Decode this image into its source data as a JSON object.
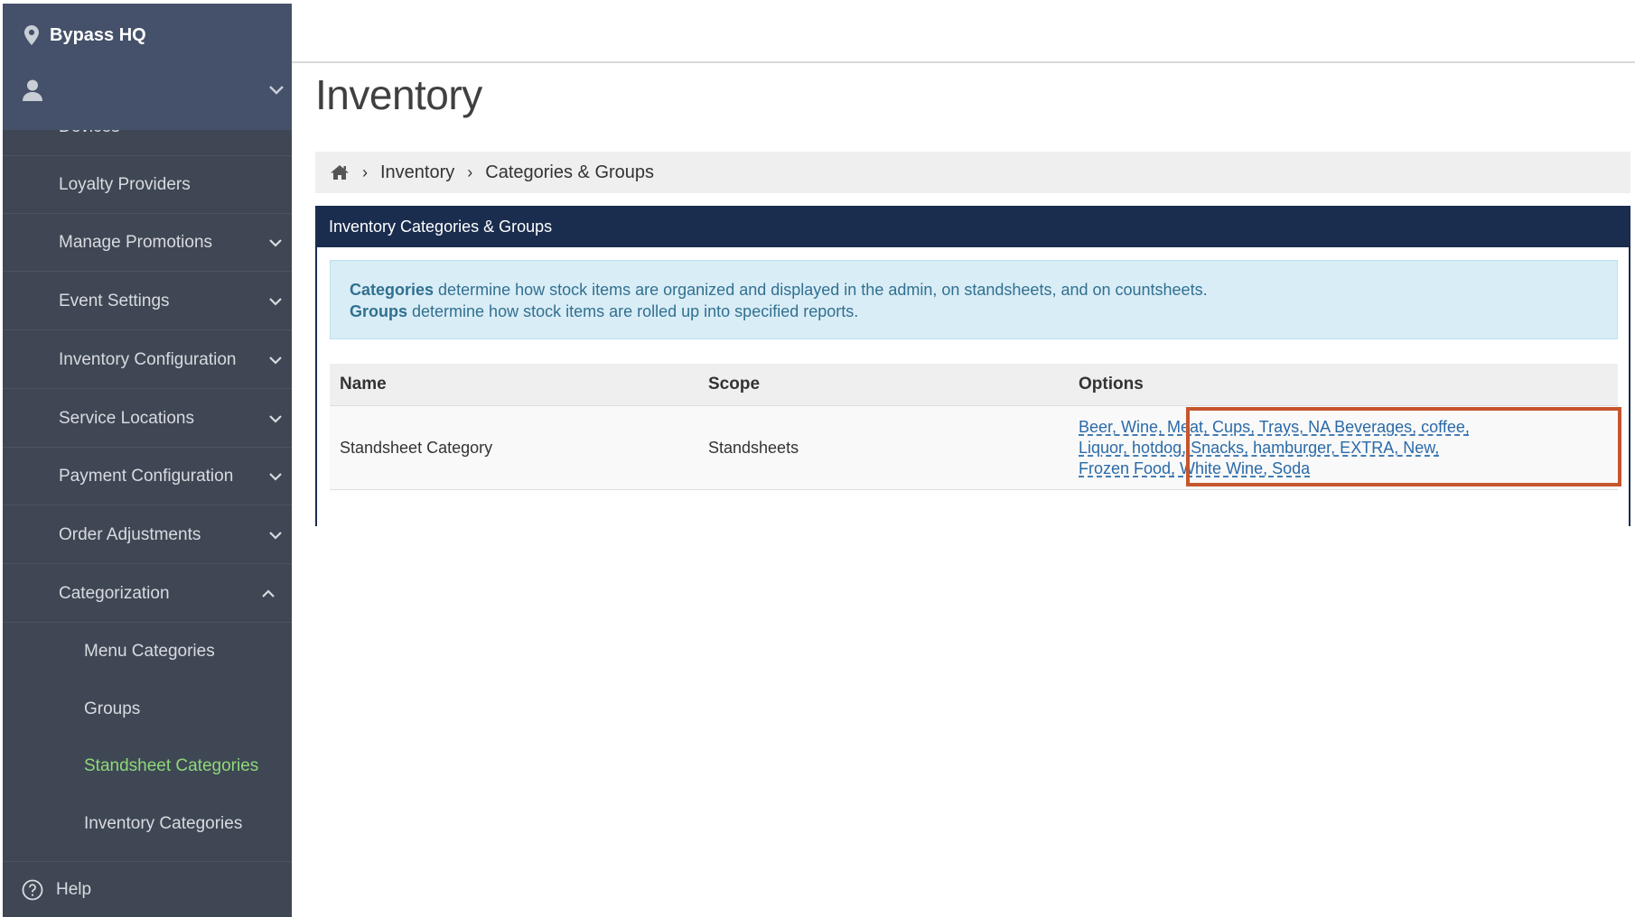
{
  "sidebar": {
    "venue": "Bypass HQ",
    "items": [
      {
        "label": "Devices",
        "type": "sub"
      },
      {
        "label": "Loyalty Providers",
        "type": "sub"
      },
      {
        "label": "Manage Promotions",
        "type": "group"
      },
      {
        "label": "Event Settings",
        "type": "group"
      },
      {
        "label": "Inventory Configuration",
        "type": "group"
      },
      {
        "label": "Service Locations",
        "type": "group"
      },
      {
        "label": "Payment Configuration",
        "type": "group"
      },
      {
        "label": "Order Adjustments",
        "type": "group"
      },
      {
        "label": "Categorization",
        "type": "group",
        "expanded": true
      },
      {
        "label": "Menu Categories",
        "type": "sub2"
      },
      {
        "label": "Groups",
        "type": "sub2"
      },
      {
        "label": "Standsheet Categories",
        "type": "sub2",
        "active": true
      },
      {
        "label": "Inventory Categories",
        "type": "sub2"
      }
    ],
    "help": "Help"
  },
  "page": {
    "title": "Inventory"
  },
  "breadcrumb": {
    "items": [
      "Inventory",
      "Categories & Groups"
    ]
  },
  "panel": {
    "title": "Inventory Categories & Groups",
    "info": {
      "line1_bold": "Categories",
      "line1_rest": " determine how stock items are organized and displayed in the admin, on standsheets, and on countsheets.",
      "line2_bold": "Groups",
      "line2_rest": " determine how stock items are rolled up into specified reports."
    }
  },
  "table": {
    "headers": [
      "Name",
      "Scope",
      "Options"
    ],
    "rows": [
      {
        "name": "Standsheet Category",
        "scope": "Standsheets",
        "options": "Beer, Wine, Meat, Cups, Trays, NA Beverages, coffee, Liquor, hotdog, Snacks, hamburger, EXTRA, New, Frozen Food, White Wine, Soda"
      }
    ]
  },
  "colors": {
    "sidebar_bg": "#3f4754",
    "sidebar_top": "#45516a",
    "active_item": "#8ed87a",
    "panel_header": "#1b2d4e",
    "info_bg": "#d9edf7",
    "highlight_border": "#c5562e",
    "link": "#2a6aa8"
  }
}
